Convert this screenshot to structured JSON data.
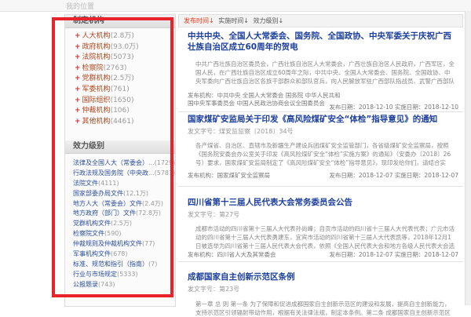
{
  "top_strip": {
    "crumb": "我的位置"
  },
  "sidebar": {
    "category_title": "制定机构",
    "categories": [
      {
        "name": "人大机构",
        "count": "(2.8万)"
      },
      {
        "name": "政府机构",
        "count": "(93.0万)"
      },
      {
        "name": "法院机构",
        "count": "(5073)"
      },
      {
        "name": "检察院",
        "count": "(2763)"
      },
      {
        "name": "党群机构",
        "count": "(2.5万)"
      },
      {
        "name": "军委机构",
        "count": "(761)"
      },
      {
        "name": "国际组织",
        "count": "(1650)"
      },
      {
        "name": "仲裁机构",
        "count": "(106)"
      },
      {
        "name": "其他机构",
        "count": "(4461)"
      }
    ],
    "effect_title": "效力级别",
    "effects": [
      {
        "name": "法律及全国人大（常委会）",
        "count": "...(1729)"
      },
      {
        "name": "行政法规及国务院（中央政",
        "count": "...(5787)"
      },
      {
        "name": "法院文件",
        "count": "(4111)"
      },
      {
        "name": "国家部委办局文件",
        "count": "(12.1万)"
      },
      {
        "name": "地方人大（常委会）文件",
        "count": "(2.4万)"
      },
      {
        "name": "地方政府（部门）文件",
        "count": "(72.8万)"
      },
      {
        "name": "党群机构文件",
        "count": "(2.5万)"
      },
      {
        "name": "检察院文件",
        "count": "(590)"
      },
      {
        "name": "仲裁规则及仲裁机构文件",
        "count": "(77)"
      },
      {
        "name": "军事机构文件",
        "count": "(678)"
      },
      {
        "name": "标准、规范和指引（指南）",
        "count": "(7)"
      },
      {
        "name": "行业与市场规定",
        "count": "(5333)"
      },
      {
        "name": "公报题录",
        "count": "(743)"
      }
    ]
  },
  "sortbar": {
    "publish_time": "发布时间",
    "publish_arrow": "↓",
    "effective_time": "实施时间",
    "effective_arrow": "↓",
    "effect_level": "效力级别",
    "effect_arrow": "↓"
  },
  "articles": [
    {
      "title": "中共中央、全国人大常委会、国务院、全国政协、中央军委关于庆祝广西壮族自治区成立60周年的贺电",
      "doc": "",
      "summary": "中共广西壮族自治区委员会，广西壮族自治区人大常委会，广西壮族自治区人民政府，广西军区，全国人民，在广西壮族自治区成立60周年之际，中共中央、全国人大常委会、国务院、全国政协、中央军委向广西壮族自治区各族干部群众和部队官兵，向人民解放军驻广西部队指战员、武警广西部队官兵和政法干",
      "issuer": "发布机构：中共中央 全国人大常委会 国务院 中华人民共和国中央军事委员会 中国人民政治协商会议全国委员会",
      "publish_date": "发布日期：2018-12-10",
      "effective_date": "实施日期：2018-12-10"
    },
    {
      "title": "国家煤矿安监局关于印发《高风险煤矿安全“体检”指导意见》的通知",
      "doc": "发文字号：煤安监监察〔2018〕34号",
      "summary": "各产煤省、自治区、直辖市及新疆生产建设兵团煤矿安全监管部门，各省级煤矿安全监察局，按照《国务院安委会办公室关于印发《高风险煤矿安全“体检”实施方案》的通知》（安委办〔2018〕26号）要求，国家煤矿安监局制定了《高风险煤矿安全“体检”指导意见》，现印发给你们，请结合实际，抓好贯彻落实，内容机构",
      "issuer": "发布机构：国家煤矿安全监察局",
      "publish_date": "发布日期：2018-12-07",
      "effective_date": "实施日期：2018-12-07"
    },
    {
      "title": "四川省第十三届人民代表大会常务委员会公告",
      "doc": "发文字号：第27号",
      "summary": "成都市活动的四川省第十三届人大代表孙尚峰；自贡市活动的四川省十三届人大代表代表；广元市活动的四川省第十三届人大代表勇建东，宜宾市活动的四川省第十三届人大代表凯等，2018年12月1日被选举为四川省第十三届人民代表大会代表，依照《全国人民代表大会和地方各级人民代表大会选举法》的规定，代表资格终止，截至目前，四川省第十三届人民代表大会实有代表888人，特此公告，内容机构",
      "issuer": "发布机构：四川省人大及其常委会",
      "publish_date": "发布日期：2018-12-07",
      "effective_date": "实施日期：2018-12-07"
    },
    {
      "title": "成都国家自主创新示范区条例",
      "doc": "发文字号：第23号",
      "summary": "第一章 总 则 第一条 为了保障和促进成都国家自主创新示范区的建设和发展，提高自主创新能力，支持示范区引领辐射带动作用，根据有关法律法规，制定本条例。第二条 成都国家自主创新示范区（以下简称示范区）的建设、发展、管理、服务，推动高新技术产业发展的统筹，适用本条例。示范区应当充分发挥成都高新技术产业开发区引领和示范带动作用，完善技术创新体系",
      "issuer": "",
      "publish_date": "",
      "effective_date": ""
    }
  ],
  "colors": {
    "highlight_box": "#e8232b",
    "title_blue": "#1b3f9c",
    "category_orange": "#b3441b",
    "sort_active": "#e03c1e"
  }
}
